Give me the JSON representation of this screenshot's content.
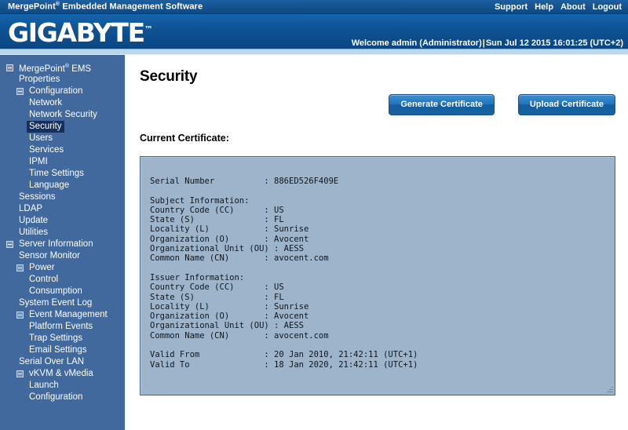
{
  "topbar": {
    "product_name_prefix": "MergePoint",
    "product_name_sup": "®",
    "product_name_suffix": " Embedded Management Software",
    "links": [
      {
        "label": "Support"
      },
      {
        "label": "Help"
      },
      {
        "label": "About"
      },
      {
        "label": "Logout"
      }
    ]
  },
  "brand": {
    "logo_text": "GIGABYTE",
    "logo_tm": "™",
    "welcome_user": "Welcome admin (Administrator)",
    "welcome_separator": "|",
    "welcome_datetime": "Sun Jul 12 2015 16:01:25 (UTC+2)"
  },
  "sidebar": {
    "items": [
      {
        "label": "MergePoint",
        "sup": "®",
        "label2": " EMS",
        "level": 0,
        "expander": true,
        "selected": false
      },
      {
        "label": "Properties",
        "level": 1,
        "expander": false,
        "selected": false
      },
      {
        "label": "Configuration",
        "level": 1,
        "expander": true,
        "selected": false
      },
      {
        "label": "Network",
        "level": 2,
        "expander": false,
        "selected": false
      },
      {
        "label": "Network Security",
        "level": 2,
        "expander": false,
        "selected": false
      },
      {
        "label": "Security",
        "level": 2,
        "expander": false,
        "selected": true
      },
      {
        "label": "Users",
        "level": 2,
        "expander": false,
        "selected": false
      },
      {
        "label": "Services",
        "level": 2,
        "expander": false,
        "selected": false
      },
      {
        "label": "IPMI",
        "level": 2,
        "expander": false,
        "selected": false
      },
      {
        "label": "Time Settings",
        "level": 2,
        "expander": false,
        "selected": false
      },
      {
        "label": "Language",
        "level": 2,
        "expander": false,
        "selected": false
      },
      {
        "label": "Sessions",
        "level": 1,
        "expander": false,
        "selected": false
      },
      {
        "label": "LDAP",
        "level": 1,
        "expander": false,
        "selected": false
      },
      {
        "label": "Update",
        "level": 1,
        "expander": false,
        "selected": false
      },
      {
        "label": "Utilities",
        "level": 1,
        "expander": false,
        "selected": false
      },
      {
        "label": "Server Information",
        "level": 0,
        "expander": true,
        "selected": false
      },
      {
        "label": "Sensor Monitor",
        "level": 1,
        "expander": false,
        "selected": false
      },
      {
        "label": "Power",
        "level": 1,
        "expander": true,
        "selected": false
      },
      {
        "label": "Control",
        "level": 2,
        "expander": false,
        "selected": false
      },
      {
        "label": "Consumption",
        "level": 2,
        "expander": false,
        "selected": false
      },
      {
        "label": "System Event Log",
        "level": 1,
        "expander": false,
        "selected": false
      },
      {
        "label": "Event Management",
        "level": 1,
        "expander": true,
        "selected": false
      },
      {
        "label": "Platform Events",
        "level": 2,
        "expander": false,
        "selected": false
      },
      {
        "label": "Trap Settings",
        "level": 2,
        "expander": false,
        "selected": false
      },
      {
        "label": "Email Settings",
        "level": 2,
        "expander": false,
        "selected": false
      },
      {
        "label": "Serial Over LAN",
        "level": 1,
        "expander": false,
        "selected": false
      },
      {
        "label": "vKVM & vMedia",
        "level": 1,
        "expander": true,
        "selected": false
      },
      {
        "label": "Launch",
        "level": 2,
        "expander": false,
        "selected": false
      },
      {
        "label": "Configuration",
        "level": 2,
        "expander": false,
        "selected": false
      }
    ]
  },
  "main": {
    "page_title": "Security",
    "generate_button": "Generate Certificate",
    "upload_button": "Upload Certificate",
    "section_label": "Current Certificate:",
    "certificate_text": "Serial Number          : 886ED526F409E\n\nSubject Information:\nCountry Code (CC)      : US\nState (S)              : FL\nLocality (L)           : Sunrise\nOrganization (O)       : Avocent\nOrganizational Unit (OU) : AESS\nCommon Name (CN)       : avocent.com\n\nIssuer Information:\nCountry Code (CC)      : US\nState (S)              : FL\nLocality (L)           : Sunrise\nOrganization (O)       : Avocent\nOrganizational Unit (OU) : AESS\nCommon Name (CN)       : avocent.com\n\nValid From             : 20 Jan 2010, 21:42:11 (UTC+1)\nValid To               : 18 Jan 2020, 21:42:11 (UTC+1)"
  }
}
